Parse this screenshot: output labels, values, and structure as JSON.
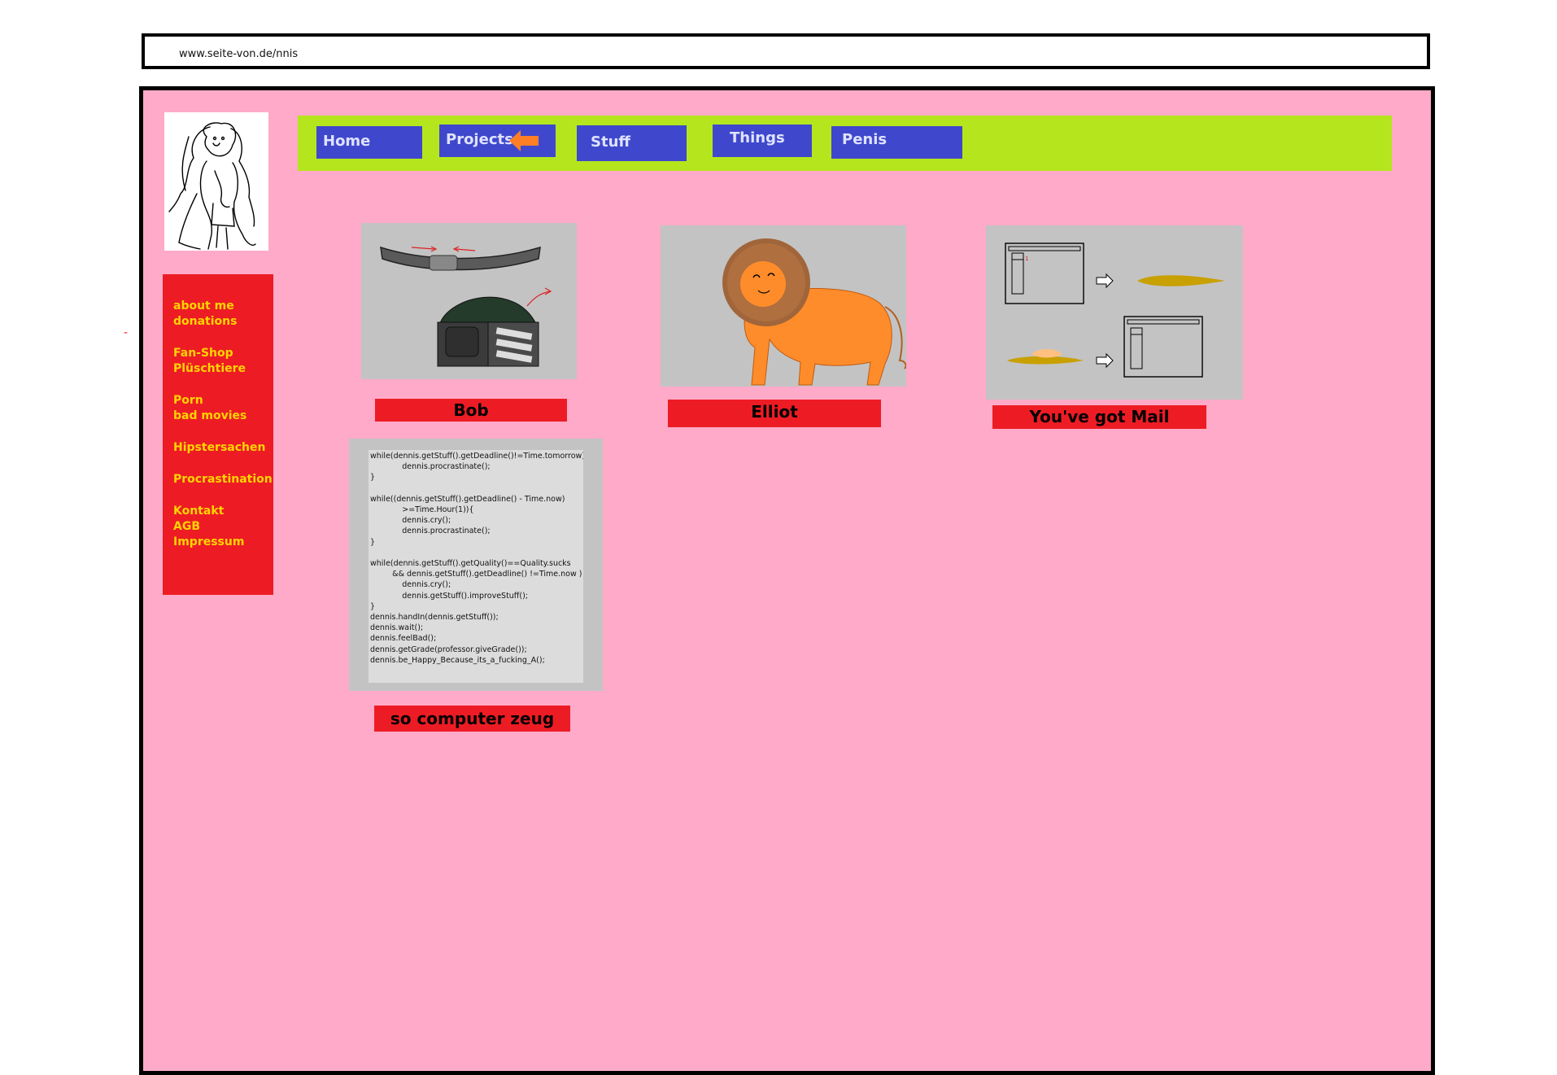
{
  "url": "www.seite-von.de/nnis",
  "top_nav": [
    "Home",
    "Projects",
    "Stuff",
    "Things",
    "Penis"
  ],
  "side_nav": [
    "about me",
    "donations",
    "Fan-Shop",
    "Plüschtiere",
    "Porn",
    "bad movies",
    "Hipstersachen",
    "Procrastination",
    "Kontakt",
    "AGB",
    "Impressum"
  ],
  "stray_mark": "-",
  "projects": [
    "Bob",
    "Elliot",
    "You've got Mail",
    "so computer zeug"
  ],
  "code": "while(dennis.getStuff().getDeadline()!=Time.tomorrow)\n             dennis.procrastinate();\n}\n\nwhile((dennis.getStuff().getDeadline() - Time.now)\n             >=Time.Hour(1)){\n             dennis.cry();\n             dennis.procrastinate();\n}\n\nwhile(dennis.getStuff().getQuality()==Quality.sucks\n         && dennis.getStuff().getDeadline() !=Time.now )\n             dennis.cry();\n             dennis.getStuff().improveStuff();\n}\ndennis.handIn(dennis.getStuff());\ndennis.wait();\ndennis.feelBad();\ndennis.getGrade(professor.giveGrade());\ndennis.be_Happy_Because_its_a_fucking_A();",
  "colors": {
    "page_bg": "#ffaac8",
    "nav_bar": "#b5e61d",
    "nav_button": "#3f48cc",
    "sidebar": "#ed1c24",
    "sidebar_text": "#ffd400",
    "label_bg": "#ed1c24",
    "card_bg": "#c3c3c3",
    "arrow": "#ff7f27"
  }
}
